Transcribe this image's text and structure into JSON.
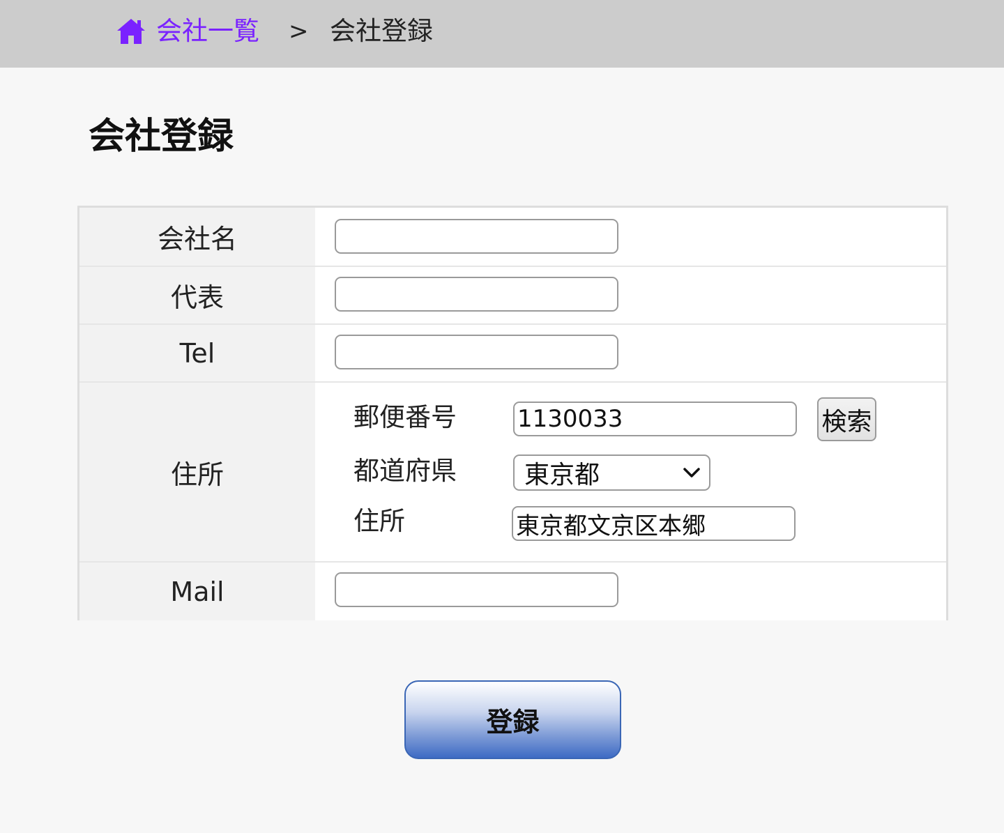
{
  "breadcrumb": {
    "home_label": "会社一覧",
    "home_icon": "home-icon",
    "separator": ">",
    "current": "会社登録"
  },
  "page": {
    "title": "会社登録"
  },
  "form": {
    "company_name": {
      "label": "会社名",
      "value": ""
    },
    "representative": {
      "label": "代表",
      "value": ""
    },
    "tel": {
      "label": "Tel",
      "value": ""
    },
    "address": {
      "label": "住所",
      "postal_label": "郵便番号",
      "postal_value": "1130033",
      "search_label": "検索",
      "prefecture_label": "都道府県",
      "prefecture_value": "東京都",
      "address_label": "住所",
      "address_value": "東京都文京区本郷"
    },
    "mail": {
      "label": "Mail",
      "value": ""
    },
    "submit_label": "登録"
  },
  "colors": {
    "breadcrumb_bg": "#cccccc",
    "link": "#7a22ff",
    "page_bg": "#f7f7f7",
    "label_bg": "#f2f2f2",
    "button_blue": "#3e6bc4"
  }
}
